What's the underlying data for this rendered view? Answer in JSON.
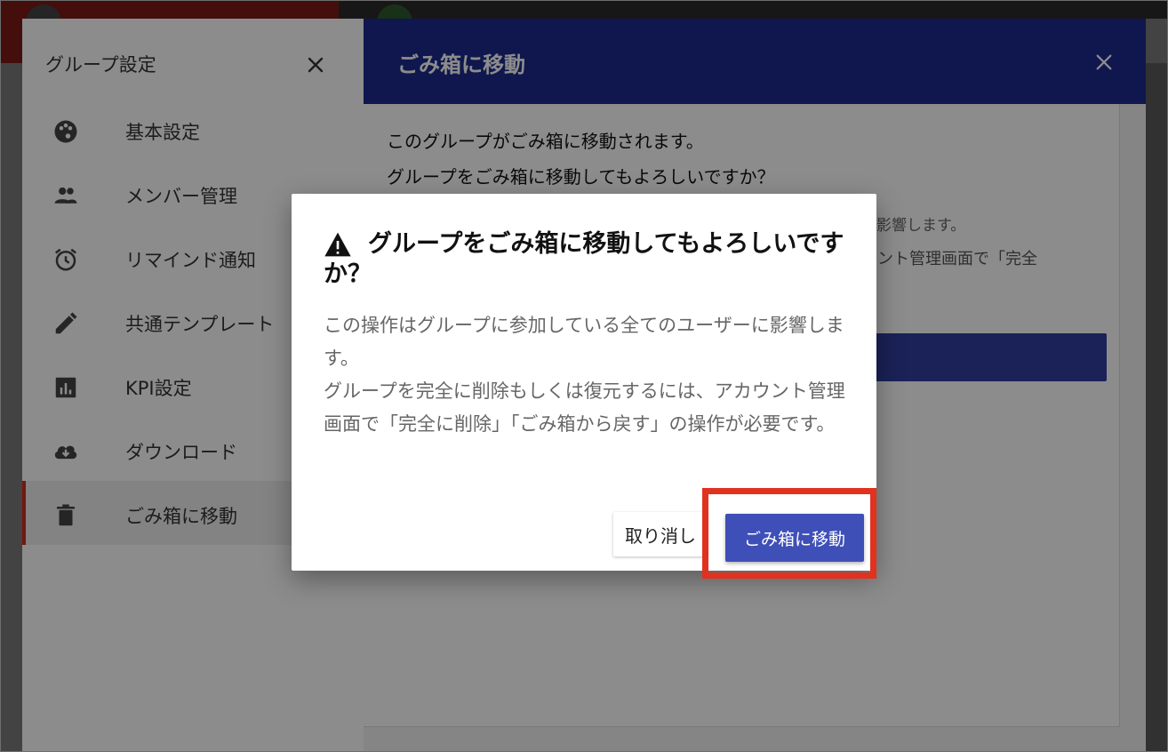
{
  "sidebar": {
    "title": "グループ設定",
    "items": [
      {
        "label": "基本設定",
        "icon": "palette-icon"
      },
      {
        "label": "メンバー管理",
        "icon": "people-icon"
      },
      {
        "label": "リマインド通知",
        "icon": "alarm-icon"
      },
      {
        "label": "共通テンプレート",
        "icon": "pencil-icon"
      },
      {
        "label": "KPI設定",
        "icon": "bar-chart-icon"
      },
      {
        "label": "ダウンロード",
        "icon": "cloud-download-icon"
      },
      {
        "label": "ごみ箱に移動",
        "icon": "trash-icon",
        "active": true
      }
    ]
  },
  "content": {
    "title": "ごみ箱に移動",
    "line1": "このグループがごみ箱に移動されます。",
    "line2": "グループをごみ箱に移動してもよろしいですか？",
    "note1": "に影響します。",
    "note2": "ウント管理画面で「完全"
  },
  "dialog": {
    "title": "グループをごみ箱に移動してもよろしいですか？",
    "body": "この操作はグループに参加している全てのユーザーに影響します。\nグループを完全に削除もしくは復元するには、アカウント管理画面で「完全に削除」「ごみ箱から戻す」の操作が必要です。",
    "cancel_label": "取り消し",
    "confirm_label": "ごみ箱に移動"
  },
  "colors": {
    "header": "#1c2a8f",
    "primary_button": "#3f4fb8",
    "active_accent": "#d52a1c",
    "highlight": "#e0321f"
  }
}
